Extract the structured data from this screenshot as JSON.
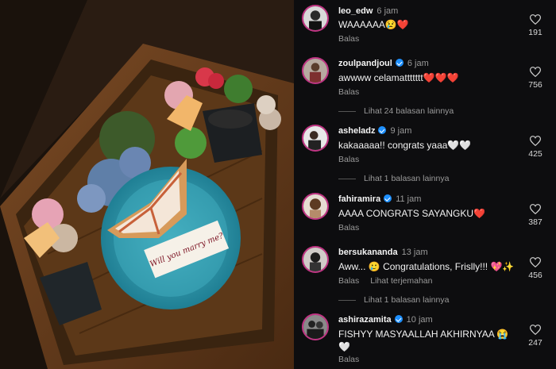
{
  "comments": [
    {
      "username": "leo_edw",
      "verified": false,
      "time": "6 jam",
      "text": "WAAAAAA😢❤️",
      "reply": "Balas",
      "likes": "191"
    },
    {
      "username": "zoulpandjoul",
      "verified": true,
      "time": "6 jam",
      "text": "awwww celamattttttt❤️❤️❤️",
      "reply": "Balas",
      "likes": "756"
    },
    {
      "username": "asheladz",
      "verified": true,
      "time": "9 jam",
      "text": "kakaaaaa!! congrats yaaa🤍🤍",
      "reply": "Balas",
      "likes": "425"
    },
    {
      "username": "fahiramira",
      "verified": true,
      "time": "11 jam",
      "text": "AAAA CONGRATS SAYANGKU❤️",
      "reply": "Balas",
      "likes": "387"
    },
    {
      "username": "bersukananda",
      "verified": false,
      "time": "13 jam",
      "text": "Aww... 🥲 Congratulations, Frislly!!! 💖✨",
      "reply": "Balas",
      "translate": "Lihat terjemahan",
      "likes": "456"
    },
    {
      "username": "ashirazamita",
      "verified": true,
      "time": "10 jam",
      "text": "FISHYY MASYAALLAH AKHIRNYAA 😭🤍",
      "reply": "Balas",
      "likes": "247"
    }
  ],
  "more_replies": [
    "Lihat 24 balasan lainnya",
    "Lihat 1 balasan lainnya",
    "Lihat 1 balasan lainnya"
  ],
  "photo": {
    "sign_text": "Will you marry me?"
  },
  "colors": {
    "panel_bg": "#0d0d0f",
    "verified": "#1e90ff",
    "avatar_ring": "#c13584"
  }
}
